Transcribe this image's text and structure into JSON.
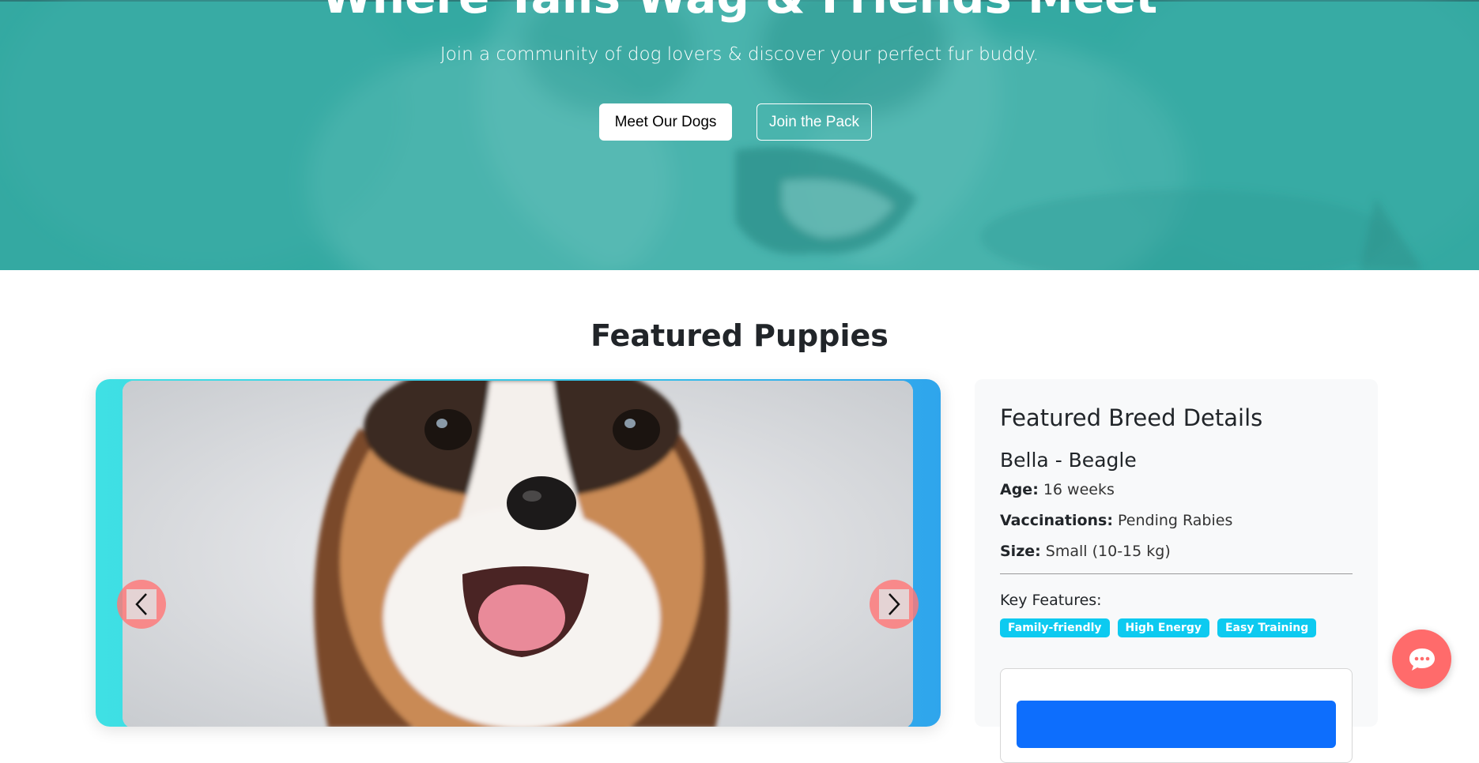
{
  "hero": {
    "title": "Where Tails Wag & Friends Meet",
    "subtitle": "Join a community of dog lovers & discover your perfect fur buddy.",
    "buttons": {
      "meet_label": "Meet Our Dogs",
      "join_label": "Join the Pack"
    },
    "overlay_color": "#3aa9a2"
  },
  "featured": {
    "heading": "Featured Puppies",
    "carousel": {
      "prev_icon": "chevron-left-icon",
      "next_icon": "chevron-right-icon"
    }
  },
  "details": {
    "heading": "Featured Breed Details",
    "dog_title": "Bella - Beagle",
    "age_label": "Age:",
    "age_value": "16 weeks",
    "vacc_label": "Vaccinations:",
    "vacc_value": "Pending Rabies",
    "size_label": "Size:",
    "size_value": "Small (10-15 kg)",
    "key_features_label": "Key Features:",
    "features": [
      "Family-friendly",
      "High Energy",
      "Easy Training"
    ]
  },
  "chat": {
    "icon": "chat-bubble-icon",
    "color": "#ff6b6b"
  },
  "colors": {
    "badge": "#0dcaf0",
    "primary": "#0d6efd"
  }
}
